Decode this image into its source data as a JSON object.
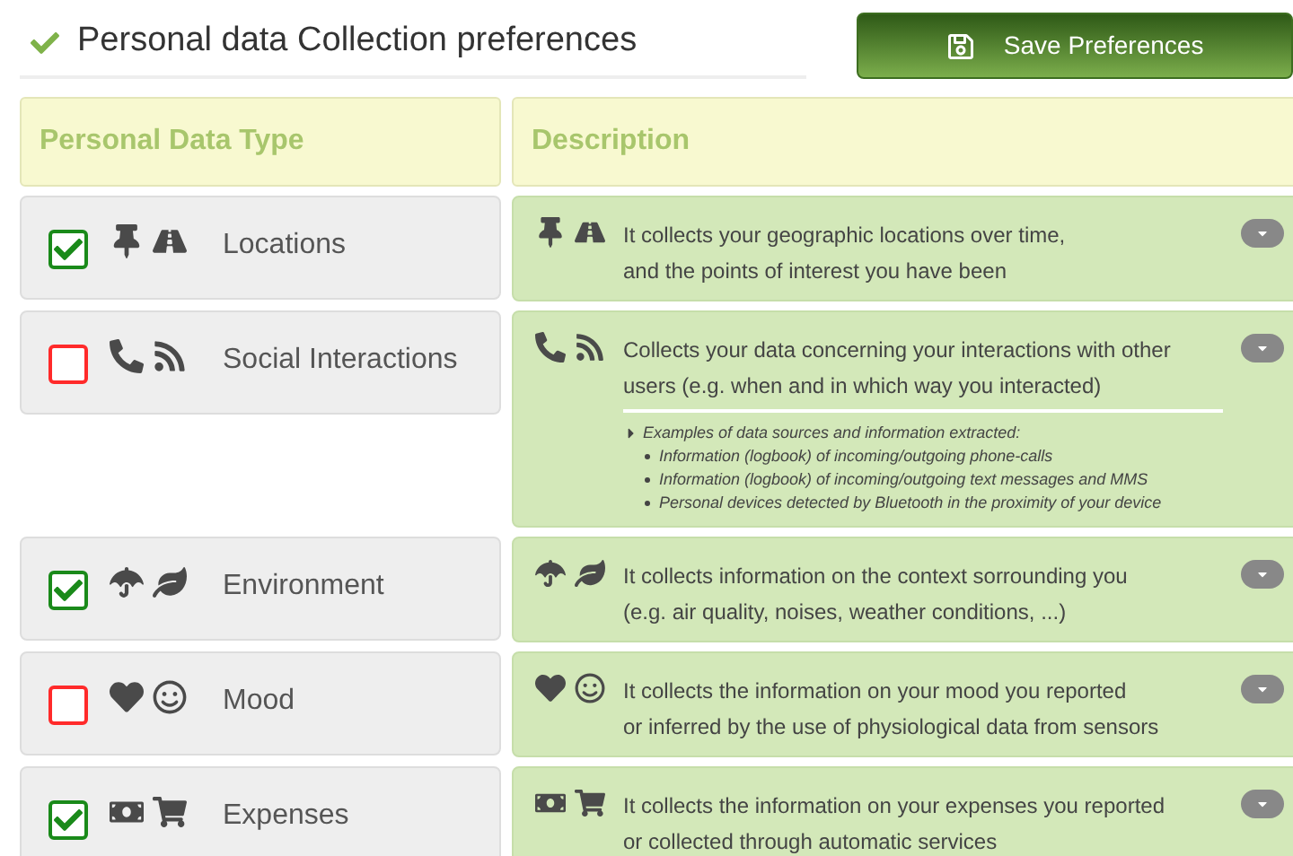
{
  "title": "Personal data Collection preferences",
  "save_button": "Save Preferences",
  "table": {
    "columns": [
      "Personal Data Type",
      "Description"
    ],
    "rows": [
      {
        "kind": "locations",
        "label": "Locations",
        "checked": true,
        "lines": [
          "It collects your geographic locations over time,",
          "and the points of interest you have been"
        ]
      },
      {
        "kind": "social",
        "label": "Social Interactions",
        "checked": false,
        "lines": [
          "Collects your data concerning your interactions with other",
          "users (e.g. when and in which way you interacted)"
        ],
        "details": {
          "heading": "Examples of data sources and information extracted:",
          "items": [
            "Information (logbook) of incoming/outgoing phone-calls",
            "Information (logbook) of incoming/outgoing text messages and MMS",
            "Personal devices detected by Bluetooth in the proximity of your device"
          ]
        }
      },
      {
        "kind": "environment",
        "label": "Environment",
        "checked": true,
        "lines": [
          "It collects information on the context sorrounding you",
          "(e.g. air quality, noises, weather conditions, ...)"
        ]
      },
      {
        "kind": "mood",
        "label": "Mood",
        "checked": false,
        "lines": [
          "It collects the information on your mood you reported",
          "or inferred by the use of physiological data from sensors"
        ]
      },
      {
        "kind": "expenses",
        "label": "Expenses",
        "checked": true,
        "lines": [
          "It collects the information on your expenses you reported",
          "or collected through automatic services"
        ]
      }
    ]
  }
}
